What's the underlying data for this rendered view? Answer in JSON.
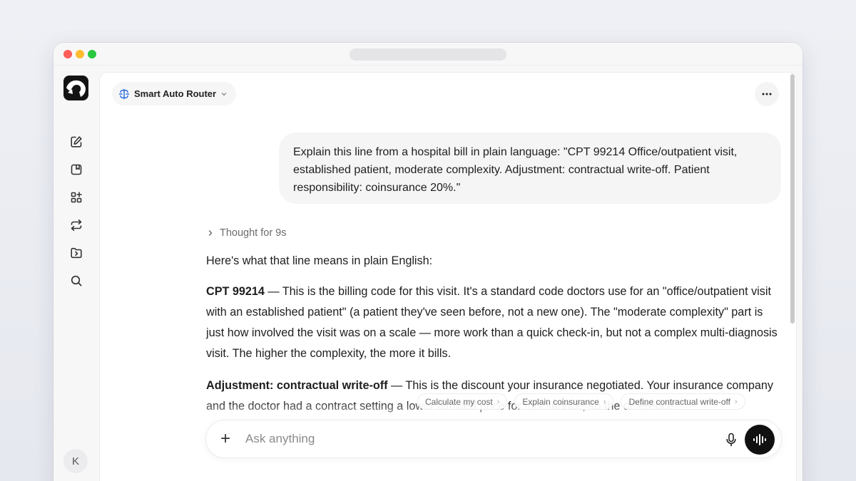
{
  "header": {
    "model_label": "Smart Auto Router"
  },
  "icons": {
    "sidebar": [
      "new-chat-icon",
      "library-icon",
      "apps-icon",
      "switch-icon",
      "folder-icon",
      "search-icon"
    ],
    "model": "router-icon",
    "more": "more-icon",
    "mic": "mic-icon",
    "voice": "voice-icon"
  },
  "user": {
    "avatar_initial": "K",
    "message": "Explain this line from a hospital bill in plain language: \"CPT 99214 Office/outpatient visit, established patient, moderate complexity. Adjustment: contractual write-off. Patient responsibility: coinsurance 20%.\""
  },
  "assistant": {
    "thought_label": "Thought for 9s",
    "intro": "Here's what that line means in plain English:",
    "sections": [
      {
        "term": "CPT 99214",
        "text": " — This is the billing code for this visit. It's a standard code doctors use for an \"office/outpatient visit with an established patient\" (a patient they've seen before, not a new one). The \"moderate complexity\" part is just how involved the visit was on a scale — more work than a quick check-in, but not a complex multi-diagnosis visit. The higher the complexity, the more it bills."
      },
      {
        "term": "Adjustment: contractual write-off",
        "text": " — This is the discount your insurance negotiated. Your insurance company and the doctor had a contract setting a lower allowed price for this service, so the difference"
      }
    ]
  },
  "suggestions": [
    "Calculate my cost",
    "Explain coinsurance",
    "Define contractual write-off"
  ],
  "composer": {
    "placeholder": "Ask anything",
    "plus_label": "+"
  },
  "colors": {
    "accent_router": "#2f6fe0",
    "close": "#ff5f57",
    "minimize": "#febc2e",
    "zoom": "#28c840"
  }
}
